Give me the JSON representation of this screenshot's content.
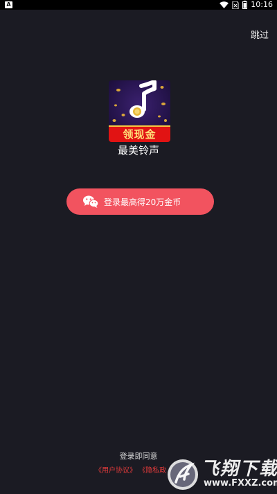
{
  "status_bar": {
    "notification_letter": "A",
    "time": "10:16"
  },
  "header": {
    "skip_label": "跳过"
  },
  "app": {
    "logo_banner_text": "领现金",
    "name": "最美铃声"
  },
  "login": {
    "button_label": "登录最高得20万金币"
  },
  "footer": {
    "agree_text": "登录即同意",
    "user_agreement": "《用户协议》",
    "privacy_policy": "《隐私政"
  },
  "watermark": {
    "title": "飞翔下载",
    "url": "www.FXXZ.com"
  },
  "colors": {
    "background": "#1b1b23",
    "button": "#f2535f",
    "link": "#e23b3b"
  },
  "icons": [
    "wifi-icon",
    "no-sim-icon",
    "battery-icon",
    "music-note-icon",
    "wechat-icon",
    "watermark-logo-icon"
  ]
}
